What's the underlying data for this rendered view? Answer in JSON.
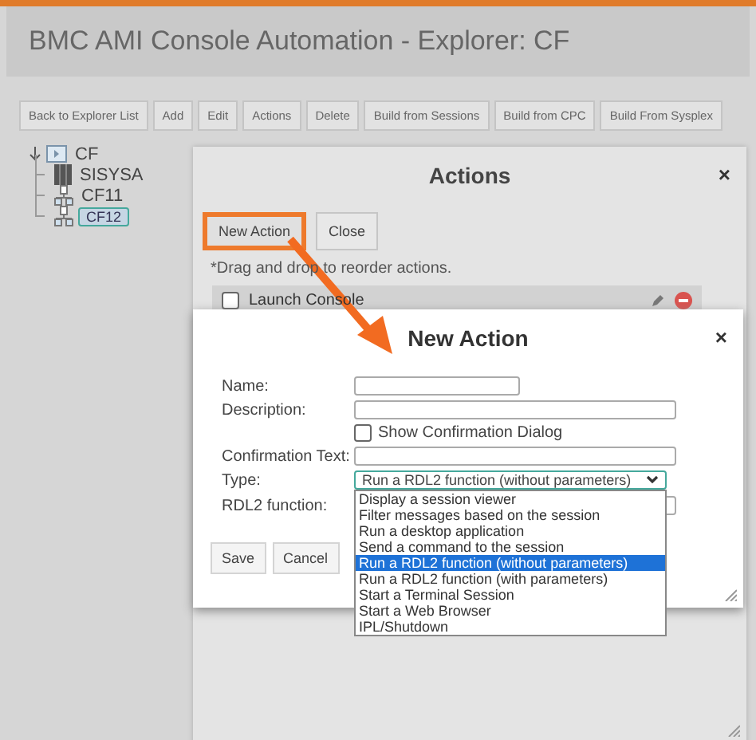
{
  "header": {
    "title": "BMC AMI Console Automation - Explorer: CF"
  },
  "toolbar": [
    "Back to Explorer List",
    "Add",
    "Edit",
    "Actions",
    "Delete",
    "Build from Sessions",
    "Build from CPC",
    "Build From Sysplex"
  ],
  "tree": {
    "label": "CF",
    "expanded": true,
    "selected": false,
    "children": [
      {
        "label": "SISYSA",
        "kind": "system",
        "selected": false
      },
      {
        "label": "CF11",
        "kind": "cf",
        "selected": false
      },
      {
        "label": "CF12",
        "kind": "cf",
        "selected": true
      }
    ]
  },
  "actions_dialog": {
    "title": "Actions",
    "close": "×",
    "buttons": [
      {
        "label": "New Action",
        "highlighted": true
      },
      {
        "label": "Close",
        "highlighted": false
      }
    ],
    "hint": "*Drag and drop to reorder actions.",
    "rows": [
      {
        "label": "Launch Console",
        "checked": false
      }
    ]
  },
  "new_action_dialog": {
    "title": "New Action",
    "close": "×",
    "name_label": "Name:",
    "description_label": "Description:",
    "confirm_checkbox": {
      "label": "Show Confirmation Dialog",
      "checked": false
    },
    "confirmation_label": "Confirmation Text:",
    "type_label": "Type:",
    "type_value": "Run a RDL2 function (without parameters)",
    "rdl2_label": "RDL2 function:",
    "type_options": [
      {
        "label": "Display a session viewer",
        "selected": false
      },
      {
        "label": "Filter messages based on the session",
        "selected": false
      },
      {
        "label": "Run a desktop application",
        "selected": false
      },
      {
        "label": "Send a command to the session",
        "selected": false
      },
      {
        "label": "Run a RDL2 function (without parameters)",
        "selected": true
      },
      {
        "label": "Run a RDL2 function (with parameters)",
        "selected": false
      },
      {
        "label": "Start a Terminal Session",
        "selected": false
      },
      {
        "label": "Start a Web Browser",
        "selected": false
      },
      {
        "label": "IPL/Shutdown",
        "selected": false
      }
    ],
    "buttons": [
      "Save",
      "Cancel"
    ]
  }
}
